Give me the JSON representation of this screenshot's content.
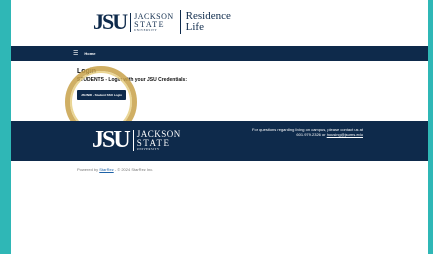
{
  "header": {
    "logo_mark": "JSU",
    "logo_word1": "JACKSON",
    "logo_word2": "STATE",
    "logo_word3": "UNIVERSITY",
    "residence_line1": "Residence",
    "residence_line2": "Life"
  },
  "navbar": {
    "home_label": "Home",
    "menu_icon": "hamburger-icon"
  },
  "main": {
    "title": "Login",
    "subtitle": "STUDENTS - Login with your JSU Credentials:",
    "login_button": "JSUNID - Student SSO Login"
  },
  "footer": {
    "logo_mark": "JSU",
    "logo_word1": "JACKSON",
    "logo_word2": "STATE",
    "logo_word3": "UNIVERSITY",
    "contact_line1": "For questions regarding living on campus, please contact us at",
    "contact_phone": "601.979.2326 or",
    "contact_email": "housing@jsums.edu"
  },
  "powered": {
    "prefix": "Powered by",
    "link": "StarRez",
    "suffix": "- © 2024 StarRez Inc."
  },
  "colors": {
    "navy": "#0e2a4b",
    "teal_background": "#2fb7b6",
    "gold_ring": "#c8a24a"
  }
}
